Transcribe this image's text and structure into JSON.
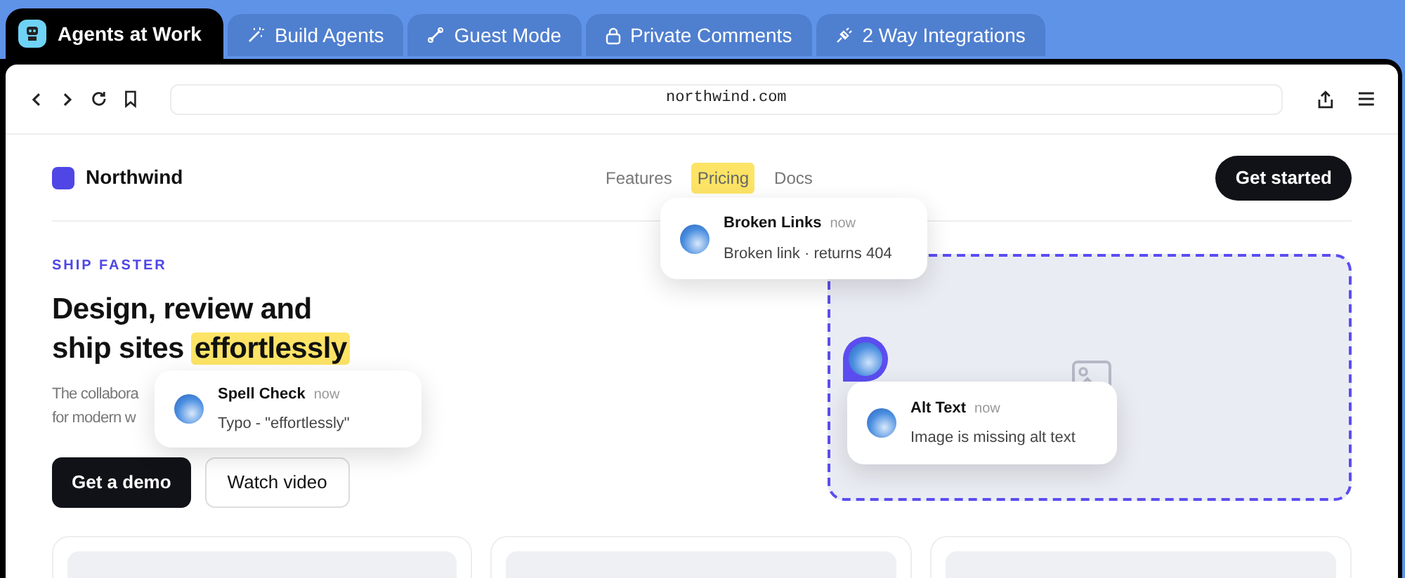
{
  "tabs": [
    {
      "label": "Agents at Work",
      "selected": true
    },
    {
      "label": "Build Agents",
      "selected": false
    },
    {
      "label": "Guest Mode",
      "selected": false
    },
    {
      "label": "Private Comments",
      "selected": false
    },
    {
      "label": "2 Way Integrations",
      "selected": false
    }
  ],
  "browser": {
    "url": "northwind.com"
  },
  "site": {
    "brand": "Northwind",
    "nav": [
      {
        "label": "Features",
        "selected": false
      },
      {
        "label": "Pricing",
        "selected": true
      },
      {
        "label": "Docs",
        "selected": false
      }
    ],
    "cta": "Get started",
    "eyebrow": "SHIP FASTER",
    "headline_lines": [
      "Design, review and",
      "ship sites"
    ],
    "headline_highlight": "effortlessly",
    "paragraph_lines": [
      "The collabora",
      "for modern w"
    ],
    "buttons": [
      {
        "label": "Get a demo",
        "kind": "primary"
      },
      {
        "label": "Watch video",
        "kind": "secondary"
      }
    ]
  },
  "comments": [
    {
      "title": "Broken Links",
      "time": "now",
      "text": "Broken link · returns 404"
    },
    {
      "title": "Spell Check",
      "time": "now",
      "text": "Typo - \"effortlessly\""
    },
    {
      "title": "Alt Text",
      "time": "now",
      "text": "Image is missing alt text"
    }
  ]
}
